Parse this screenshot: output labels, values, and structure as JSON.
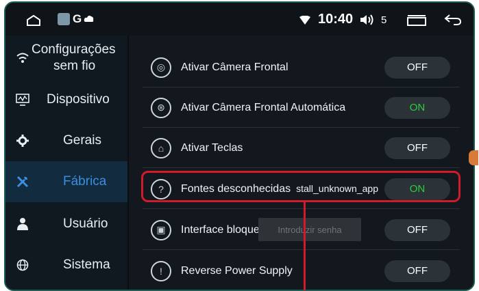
{
  "status_bar": {
    "time": "10:40",
    "volume_level": "5",
    "notification_g": "G",
    "icons": [
      "home-icon",
      "settings-notif-icon",
      "cloud-icon",
      "wifi-icon",
      "volume-icon",
      "recent-apps-icon",
      "back-icon"
    ]
  },
  "sidebar": {
    "items": [
      {
        "label": "Configurações\nsem fio",
        "line1": "Configurações",
        "line2": "sem fio",
        "icon": "wifi-icon",
        "active": false
      },
      {
        "label": "Dispositivo",
        "icon": "monitor-icon",
        "active": false
      },
      {
        "label": "Gerais",
        "icon": "gear-icon",
        "active": false
      },
      {
        "label": "Fábrica",
        "icon": "tools-icon",
        "active": true
      },
      {
        "label": "Usuário",
        "icon": "user-icon",
        "active": false
      },
      {
        "label": "Sistema",
        "icon": "globe-icon",
        "active": false
      }
    ]
  },
  "settings": {
    "rows": [
      {
        "label": "Ativar Câmera Frontal",
        "state": "OFF",
        "icon": "camera-icon"
      },
      {
        "label": "Ativar Câmera Frontal Automática",
        "state": "ON",
        "icon": "auto-camera-icon"
      },
      {
        "label": "Ativar Teclas",
        "state": "OFF",
        "icon": "keys-icon"
      },
      {
        "label": "Fontes desconhecidas",
        "extra": "stall_unknown_app",
        "state": "ON",
        "icon": "unknown-source-icon"
      },
      {
        "label": "Interface bloque",
        "state": "OFF",
        "icon": "lock-icon"
      },
      {
        "label": "Reverse Power Supply",
        "state": "OFF",
        "icon": "power-icon"
      }
    ]
  },
  "password_dialog": {
    "placeholder": "Introduzir senha"
  },
  "colors": {
    "accent": "#3a8fe0",
    "on": "#2ecc3e",
    "highlight": "#d11b2a",
    "frame": "#1f5e54"
  }
}
